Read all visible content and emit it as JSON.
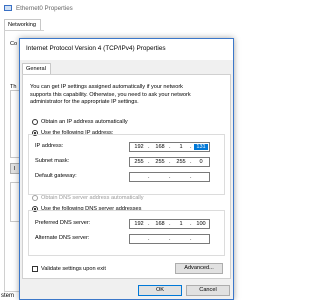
{
  "background_window": {
    "title": "Ethernet0 Properties",
    "tab": "Networking",
    "fragments": {
      "connect": "Co",
      "this": "Th",
      "install": "I",
      "footer": "stem"
    }
  },
  "dialog": {
    "title": "Internet Protocol Version 4 (TCP/IPv4) Properties",
    "tab": "General",
    "info_lines": [
      "You can get IP settings assigned automatically if your network",
      "supports this capability. Otherwise, you need to ask your network",
      "administrator for the appropriate IP settings."
    ],
    "ip": {
      "auto_label": "Obtain an IP address automatically",
      "manual_label": "Use the following IP address:",
      "selected": "manual",
      "fields": {
        "ip_address": {
          "label": "IP address:",
          "octets": [
            "192",
            "168",
            "1",
            "131"
          ]
        },
        "subnet_mask": {
          "label": "Subnet mask:",
          "octets": [
            "255",
            "255",
            "255",
            "0"
          ]
        },
        "default_gateway": {
          "label": "Default gateway:",
          "octets": [
            "",
            "",
            "",
            ""
          ]
        }
      }
    },
    "dns": {
      "auto_label": "Obtain DNS server address automatically",
      "manual_label": "Use the following DNS server addresses",
      "selected": "manual",
      "fields": {
        "preferred": {
          "label": "Preferred DNS server:",
          "octets": [
            "192",
            "168",
            "1",
            "100"
          ]
        },
        "alternate": {
          "label": "Alternate DNS server:",
          "octets": [
            "",
            "",
            "",
            ""
          ]
        }
      }
    },
    "validate_label": "Validate settings upon exit",
    "validate_checked": false,
    "advanced_label": "Advanced...",
    "ok_label": "OK",
    "cancel_label": "Cancel"
  },
  "colors": {
    "accent": "#0078d7",
    "disabled_text": "#9a9a9a",
    "dialog_bg": "#f0f0f0"
  }
}
